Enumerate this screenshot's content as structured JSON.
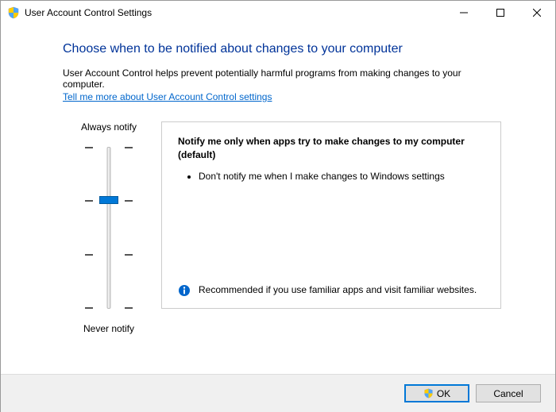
{
  "titlebar": {
    "title": "User Account Control Settings"
  },
  "content": {
    "heading": "Choose when to be notified about changes to your computer",
    "description": "User Account Control helps prevent potentially harmful programs from making changes to your computer.",
    "link": "Tell me more about User Account Control settings"
  },
  "slider": {
    "top_label": "Always notify",
    "bottom_label": "Never notify"
  },
  "info": {
    "title": "Notify me only when apps try to make changes to my computer (default)",
    "bullet1": "Don't notify me when I make changes to Windows settings",
    "recommendation": "Recommended if you use familiar apps and visit familiar websites."
  },
  "buttons": {
    "ok": "OK",
    "cancel": "Cancel"
  }
}
